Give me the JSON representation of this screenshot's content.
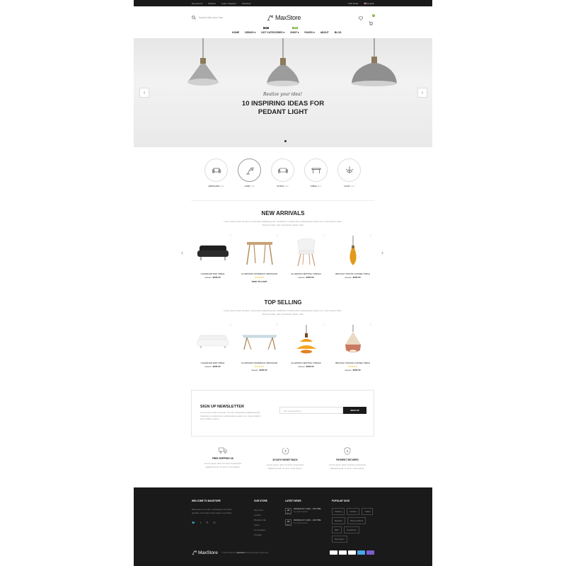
{
  "topbar": {
    "links": [
      "My account",
      "Wishlist",
      "Login / Register",
      "Checkout"
    ],
    "currency": "USD Dollar",
    "language": "English"
  },
  "header": {
    "search_placeholder": "Search entire store here",
    "logo": "MaxStore",
    "cart_count": "0"
  },
  "nav": [
    {
      "label": "HOME",
      "tag": ""
    },
    {
      "label": "DEMOS",
      "tag": ""
    },
    {
      "label": "HOT CATEGORIES",
      "tag": "HOT"
    },
    {
      "label": "SHOP",
      "tag": "NEW"
    },
    {
      "label": "PAGES",
      "tag": ""
    },
    {
      "label": "ABOUT",
      "tag": ""
    },
    {
      "label": "BLOG",
      "tag": ""
    }
  ],
  "slider": {
    "subtitle": "Realize your idea!",
    "title": "10 INSPIRING IDEAS FOR PEDANT LIGHT"
  },
  "categories": [
    {
      "name": "ARMCHAIR",
      "count": "(10)"
    },
    {
      "name": "LAMP",
      "count": "(10)"
    },
    {
      "name": "SOFAS",
      "count": "(10)"
    },
    {
      "name": "TABLE",
      "count": "(10)"
    },
    {
      "name": "LIGHT",
      "count": "(10)"
    }
  ],
  "new_arrivals": {
    "title": "NEW ARRIVALS",
    "desc": "Lorem ipsum dolor sit amet, consectetur adipisicing elit. Vestibulum condimentum pellentesque quam nec. Lorem ipsum dolor. Vivamus vitae. Sed consectetur sapien nibh.",
    "products": [
      {
        "name": "CHANDLER END TABLE",
        "old": "$99.00",
        "price": "$235.00",
        "stars": "",
        "action": ""
      },
      {
        "name": "CLARISSON WINGBACK ARMCHAIR",
        "old": "",
        "price": "",
        "stars": "★★★★★",
        "action": "TAKE TO CART"
      },
      {
        "name": "ALLERSON NESTING TABLES",
        "old": "$99.00",
        "price": "$235.00",
        "stars": "",
        "action": ""
      },
      {
        "name": "BENTLEY ROUND COFFEE TABLE",
        "old": "$99.00",
        "price": "$235.00",
        "stars": "",
        "action": ""
      }
    ]
  },
  "top_selling": {
    "title": "TOP SELLING",
    "desc": "Lorem ipsum dolor sit amet, consectetur adipisicing elit. Vestibulum condimentum pellentesque quam nec. Lorem ipsum dolor. Vivamus vitae. Sed consectetur sapien nibh.",
    "products": [
      {
        "name": "CHANDLER END TABLE",
        "old": "$99.00",
        "price": "$235.00",
        "stars": ""
      },
      {
        "name": "CLARISSON WINGBACK ARMCHAIR",
        "old": "$99.00",
        "price": "$235.00",
        "stars": "★★★★★"
      },
      {
        "name": "ALLERSON NESTING TABLES",
        "old": "$99.00",
        "price": "$235.00",
        "stars": ""
      },
      {
        "name": "BENTLEY ROUND COFFEE TABLE",
        "old": "$99.00",
        "price": "$235.00",
        "stars": "★★★★★"
      }
    ]
  },
  "newsletter": {
    "title": "SIGN UP NEWSLETTER",
    "desc": "Lorem ipsum dolor sit amet. Ut enim consectetur adipisicing elit. Vestibulum condimentum pellentesque quam nec, vitae tincidunt tortor finibus. Ipsum.",
    "placeholder": "Your email address",
    "button": "SIGN UP"
  },
  "features": [
    {
      "title": "FREE SHIPPING UK",
      "desc": "Lorem ipsum dolor sit amet consectetur adipisicing elit. Ut enim. Cras dolore."
    },
    {
      "title": "30 DAYS MONEY BACK",
      "desc": "Lorem ipsum dolor sit amet consectetur adipisicing elit. Ut enim. Cras dolore."
    },
    {
      "title": "PAYMENT SECURED",
      "desc": "Lorem ipsum dolor sit amet consectetur adipisicing elit. Ut enim. Cras dolore."
    }
  ],
  "footer": {
    "welcome_title": "WELCOME TO MAXSTORE",
    "welcome_text": "Maecenas sem nibh, scelerisque vel porta gravida, commodo luctus ipsum et porttitor.",
    "store_title": "OUR STORE",
    "stores": [
      "New York",
      "London",
      "Brooklyn NE",
      "Tokyo",
      "Los Angeles",
      "Chicago"
    ],
    "news_title": "LATEST NEWS",
    "news": [
      {
        "day": "23",
        "month": "AUG",
        "title": "MINIMALIST LAND - VESTIBE",
        "by": "by Lorem Ipsum"
      },
      {
        "day": "23",
        "month": "AUG",
        "title": "MINIMALIST LAND - VESTIBE",
        "by": "by Lorem Ipsum"
      }
    ],
    "tags_title": "POPULAR TAGS",
    "tags": [
      "Clothing",
      "Fashion",
      "T-Shirt",
      "Beauties",
      "Shoes & Boots",
      "Bath",
      "Jewelleries",
      "Decoration"
    ],
    "logo": "MaxStore",
    "copyright_pre": "© 2022 Plaza Art",
    "copyright_brand": "MaxStore",
    "copyright_post": "Shop All Rights Reserved",
    "payment_colors": [
      "#2d6cc0",
      "#eb6a1f",
      "#4aa6e6",
      "#1f4e9b",
      "#e94b3c"
    ]
  },
  "colors": {
    "dark": "#1a1a1a",
    "accent_green": "#7cb342",
    "hot_tag": "#e84c3d",
    "new_tag": "#7cb342"
  }
}
